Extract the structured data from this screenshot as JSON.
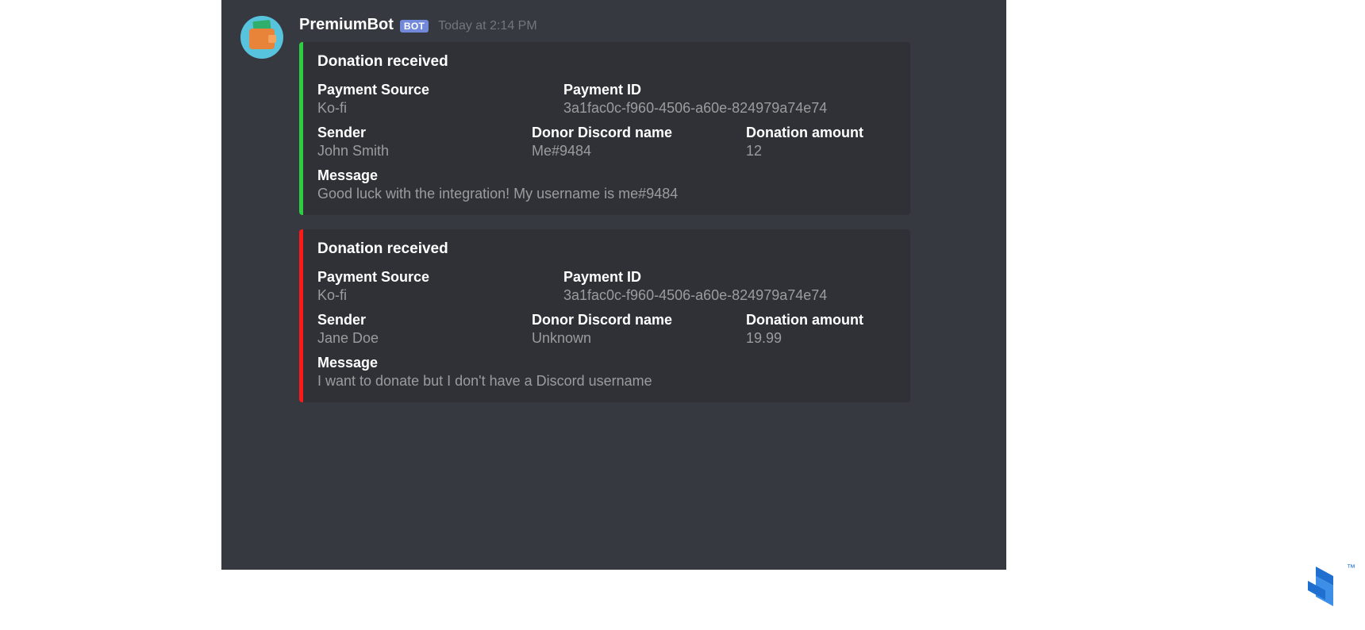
{
  "header": {
    "username": "PremiumBot",
    "bot_tag": "BOT",
    "timestamp": "Today at 2:14 PM"
  },
  "labels": {
    "embed_title": "Donation received",
    "payment_source": "Payment Source",
    "payment_id": "Payment ID",
    "sender": "Sender",
    "donor_discord": "Donor Discord name",
    "donation_amount": "Donation amount",
    "message": "Message"
  },
  "colors": {
    "success": "#2ecc40",
    "error": "#ff1a1a"
  },
  "embeds": [
    {
      "color_key": "success",
      "payment_source": "Ko-fi",
      "payment_id": "3a1fac0c-f960-4506-a60e-824979a74e74",
      "sender": "John Smith",
      "donor_discord": "Me#9484",
      "donation_amount": "12",
      "message": "Good luck with the integration! My username is me#9484"
    },
    {
      "color_key": "error",
      "payment_source": "Ko-fi",
      "payment_id": "3a1fac0c-f960-4506-a60e-824979a74e74",
      "sender": "Jane Doe",
      "donor_discord": "Unknown",
      "donation_amount": "19.99",
      "message": "I want to donate but I don't have a Discord username"
    }
  ],
  "logo": {
    "tm": "™"
  }
}
